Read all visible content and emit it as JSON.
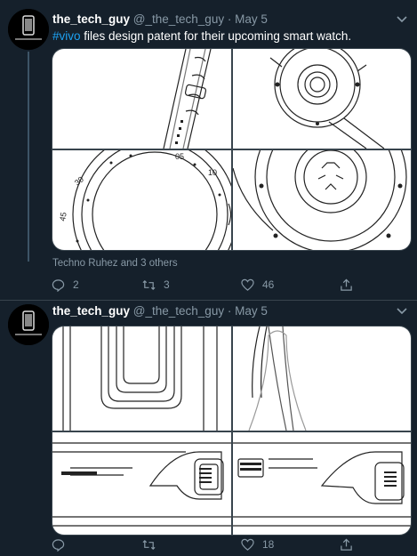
{
  "tweets": [
    {
      "display_name": "the_tech_guy",
      "handle": "@_the_tech_guy",
      "separator": "·",
      "date": "May 5",
      "hashtag": "#vivo",
      "text": " files design patent for their upcoming smart watch.",
      "social_context": "Techno Ruhez and 3 others",
      "replies": "2",
      "retweets": "3",
      "likes": "46"
    },
    {
      "display_name": "the_tech_guy",
      "handle": "@_the_tech_guy",
      "separator": "·",
      "date": "May 5",
      "replies": "",
      "retweets": "",
      "likes": "18"
    }
  ],
  "icons": {
    "avatar": "phone-avatar-icon",
    "more": "chevron-down-icon",
    "reply": "reply-icon",
    "retweet": "retweet-icon",
    "like": "heart-icon",
    "share": "share-icon"
  },
  "colors": {
    "background": "#15202b",
    "secondary_text": "#8899a6",
    "link": "#1da1f2",
    "divider": "#38444d"
  },
  "media": {
    "tweet1": [
      "watch-strap-drawing",
      "watch-back-drawing",
      "watch-bezel-drawing",
      "watch-sensor-drawing"
    ],
    "tweet2": [
      "watch-side-drawing",
      "strap-lug-drawing",
      "crown-drawing-left",
      "crown-drawing-right"
    ]
  }
}
